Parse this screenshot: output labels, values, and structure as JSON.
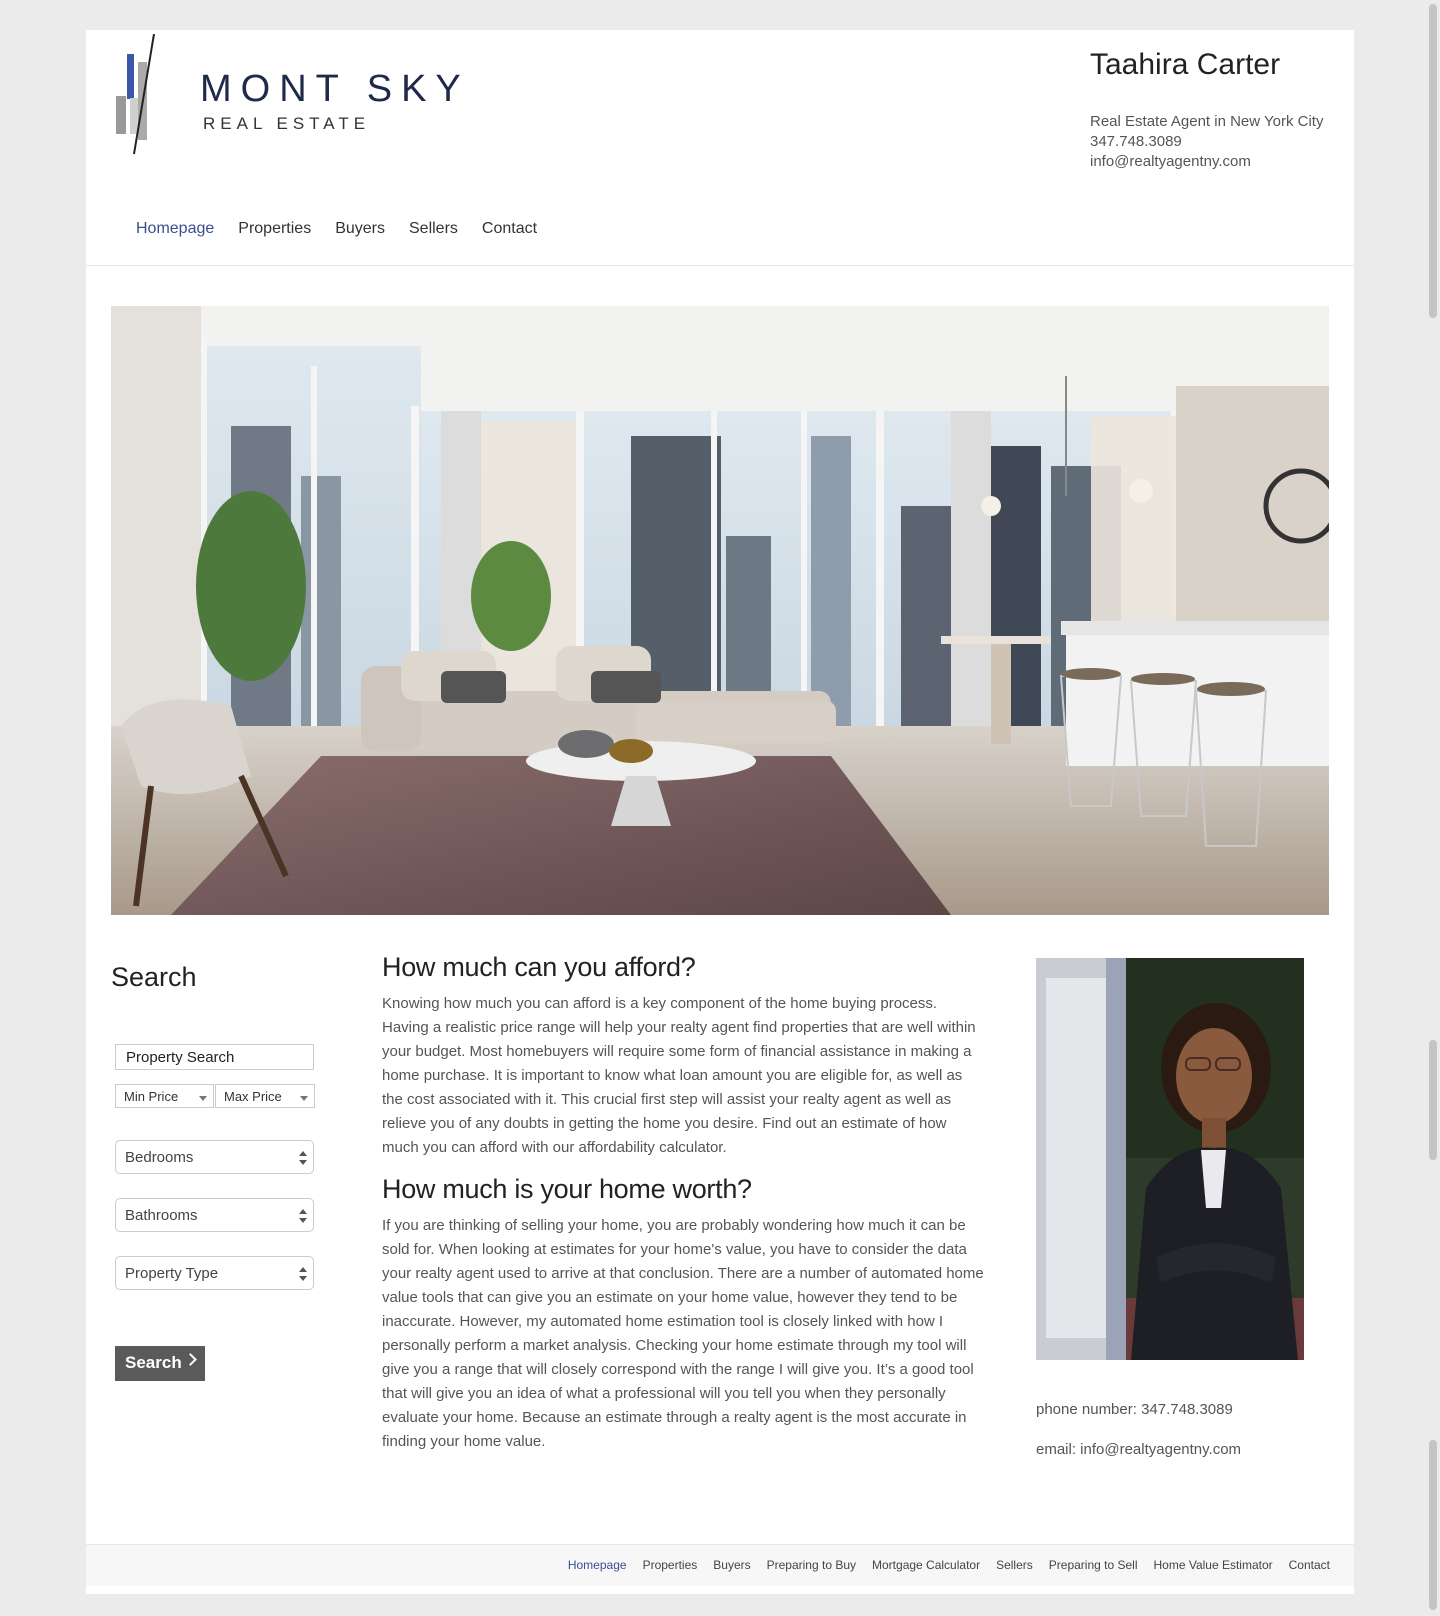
{
  "logo": {
    "main": "MONT SKY",
    "sub": "REAL ESTATE"
  },
  "agent": {
    "name": "Taahira Carter",
    "title": "Real Estate Agent in New York City",
    "phone": "347.748.3089",
    "email": "info@realtyagentny.com"
  },
  "nav": [
    {
      "label": "Homepage",
      "active": true
    },
    {
      "label": "Properties"
    },
    {
      "label": "Buyers"
    },
    {
      "label": "Sellers"
    },
    {
      "label": "Contact"
    }
  ],
  "search": {
    "title": "Search",
    "property_search_value": "Property Search",
    "min_price": "Min Price",
    "max_price": "Max Price",
    "bedrooms": "Bedrooms",
    "bathrooms": "Bathrooms",
    "property_type": "Property Type",
    "button": "Search"
  },
  "content": {
    "afford_heading": "How much can you afford?",
    "afford_body": "Knowing how much you can afford is a key component of the home buying process. Having a realistic price range will help your realty agent find properties that are well within your budget. Most homebuyers will require some form of financial assistance in making a home purchase. It is important to know what loan amount you are eligible for, as well as the cost associated with it. This crucial first step will assist your realty agent as well as relieve you of any doubts in getting the home you desire. Find out an estimate of how much you can afford with our affordability calculator.",
    "worth_heading": "How much is your home worth?",
    "worth_body": "If you are thinking of selling your home, you are probably wondering how much it can be sold for. When looking at estimates for your home's value, you have to consider the data your realty agent used to arrive at that conclusion. There are a number of automated home value tools that can give you an estimate on your home value, however they tend to be inaccurate. However, my automated home estimation tool is closely linked with how I personally perform a market analysis. Checking your home estimate through my tool will give you a range that will closely correspond with the range I will give you. It’s a good tool that will give you an idea of what a professional will you tell you when they personally evaluate your home. Because an estimate through a realty agent is the most accurate in finding your home value."
  },
  "sidebar_contact": {
    "phone": "phone number: 347.748.3089",
    "email": "email: info@realtyagentny.com"
  },
  "footer_nav": [
    {
      "label": "Homepage",
      "active": true
    },
    {
      "label": "Properties"
    },
    {
      "label": "Buyers"
    },
    {
      "label": "Preparing to Buy"
    },
    {
      "label": "Mortgage Calculator"
    },
    {
      "label": "Sellers"
    },
    {
      "label": "Preparing to Sell"
    },
    {
      "label": "Home Value Estimator"
    },
    {
      "label": "Contact"
    }
  ],
  "colors": {
    "accent": "#3b4f8f",
    "logo_blue": "#3c56a8",
    "button": "#5a5a5a"
  }
}
